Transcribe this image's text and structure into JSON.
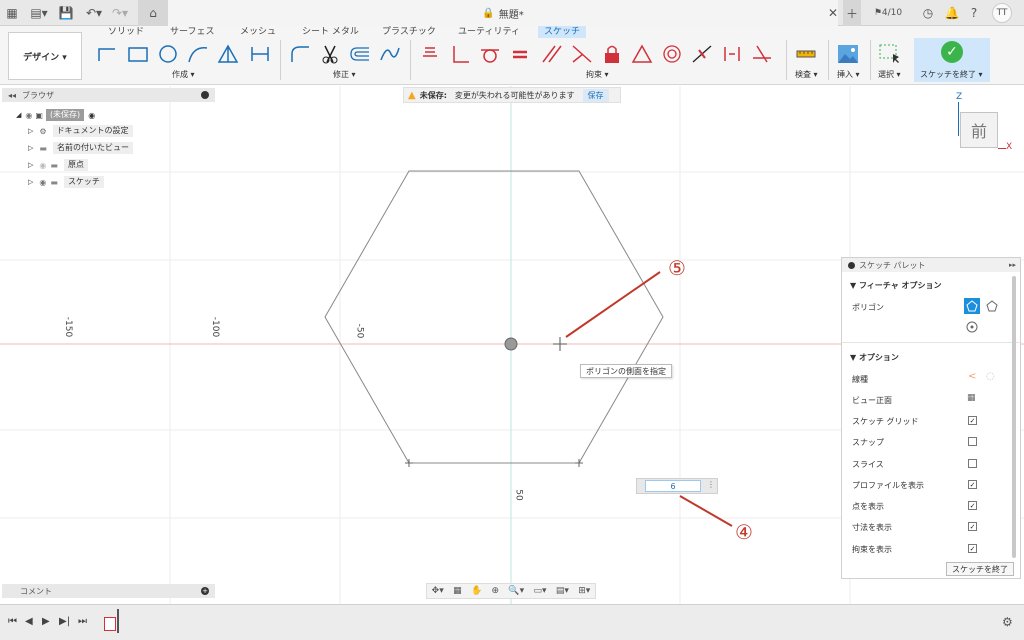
{
  "window": {
    "doc_title": "無題*",
    "page_count": "4/10",
    "user_initials": "TT"
  },
  "ribbon": {
    "workspace": "デザイン ▾",
    "tabs": [
      "ソリッド",
      "サーフェス",
      "メッシュ",
      "シート メタル",
      "プラスチック",
      "ユーティリティ",
      "スケッチ"
    ],
    "active_tab": "スケッチ",
    "groups": {
      "create": "作成 ▾",
      "modify": "修正 ▾",
      "constraints": "拘束 ▾",
      "inspect": "検査 ▾",
      "insert": "挿入 ▾",
      "select": "選択 ▾",
      "finish": "スケッチを終了 ▾"
    }
  },
  "browser": {
    "title": "ブラウザ",
    "items": [
      "(未保存)",
      "ドキュメントの設定",
      "名前の付いたビュー",
      "原点",
      "スケッチ"
    ]
  },
  "warning": {
    "label": "未保存:",
    "message": "変更が失われる可能性があります",
    "save": "保存"
  },
  "viewcube": {
    "face": "前",
    "z": "Z",
    "x": "X"
  },
  "canvas": {
    "ruler": [
      "-150",
      "-100",
      "-50",
      "50"
    ],
    "tooltip": "ポリゴンの側面を指定",
    "sides_value": "6",
    "annotation_5": "⑤",
    "annotation_4": "④"
  },
  "palette": {
    "title": "スケッチ パレット",
    "feature_section": "フィーチャ オプション",
    "polygon_label": "ポリゴン",
    "options_section": "オプション",
    "options": [
      {
        "label": "線種",
        "checked": null
      },
      {
        "label": "ビュー正面",
        "checked": null
      },
      {
        "label": "スケッチ グリッド",
        "checked": true
      },
      {
        "label": "スナップ",
        "checked": false
      },
      {
        "label": "スライス",
        "checked": false
      },
      {
        "label": "プロファイルを表示",
        "checked": true
      },
      {
        "label": "点を表示",
        "checked": true
      },
      {
        "label": "寸法を表示",
        "checked": true
      },
      {
        "label": "拘束を表示",
        "checked": true
      }
    ],
    "finish_button": "スケッチを終了"
  },
  "comments": {
    "label": "コメント"
  },
  "colors": {
    "accent": "#1b6fb8",
    "constraint_red": "#d0313a",
    "finish_green": "#3bb54a",
    "annotation_red": "#c0392b",
    "warning": "#f5a623"
  }
}
